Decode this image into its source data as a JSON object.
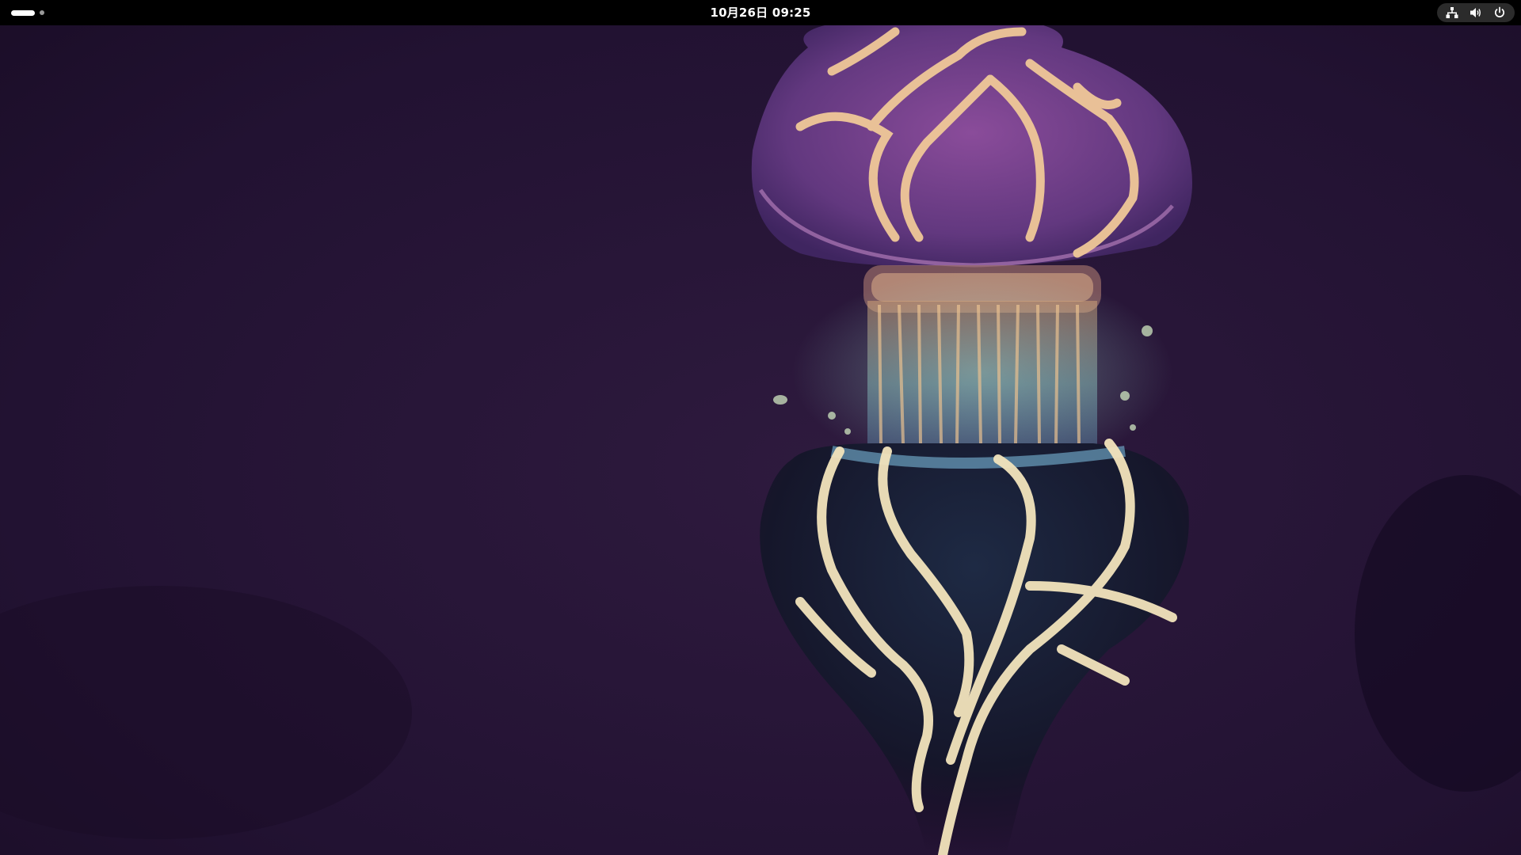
{
  "topbar": {
    "clock": "10月26日 09:25",
    "workspaces": {
      "count": 2,
      "active_index": 0
    },
    "system_icons": [
      "network-wired-icon",
      "volume-icon",
      "power-icon"
    ]
  },
  "wallpaper": {
    "subject": "jellyfish",
    "colors": {
      "background": "#1e0f2a",
      "bell": "#6a3f8e",
      "veins": "#f0c898",
      "tentacles_glow": "#7fc0c8",
      "lower_body_veins": "#f3e4bc"
    }
  },
  "colors": {
    "topbar_bg": "#000000",
    "topbar_text": "#ffffff",
    "indicator_pill_bg": "#2b2b2b"
  }
}
